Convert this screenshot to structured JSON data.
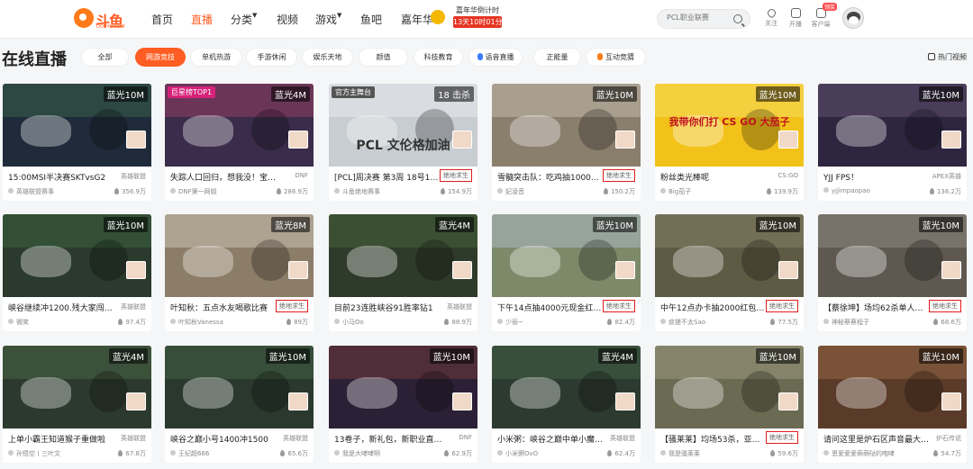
{
  "header": {
    "logo_text": "斗鱼",
    "logo_sub": "DOUYU.COM",
    "nav": [
      {
        "label": "首页",
        "active": false,
        "dropdown": false
      },
      {
        "label": "直播",
        "active": true,
        "dropdown": false
      },
      {
        "label": "分类",
        "active": false,
        "dropdown": true
      },
      {
        "label": "视频",
        "active": false,
        "dropdown": false
      },
      {
        "label": "游戏",
        "active": false,
        "dropdown": true
      },
      {
        "label": "鱼吧",
        "active": false,
        "dropdown": false
      },
      {
        "label": "嘉年华",
        "active": false,
        "dropdown": false
      }
    ],
    "countdown_title": "嘉年华倒计时",
    "countdown_value": "13天10时01分",
    "search_placeholder": "PCL职业联赛",
    "icons": [
      {
        "icon": "heart-icon",
        "label": "关注"
      },
      {
        "icon": "broadcast-icon",
        "label": "开播"
      },
      {
        "icon": "download-icon",
        "label": "客户端",
        "badge": "领奖"
      }
    ]
  },
  "page_title": "在线直播",
  "filters": [
    {
      "label": "全部",
      "active": false
    },
    {
      "label": "网游竞技",
      "active": true
    },
    {
      "label": "单机热游",
      "active": false
    },
    {
      "label": "手游休闲",
      "active": false
    },
    {
      "label": "娱乐天地",
      "active": false
    },
    {
      "label": "颜值",
      "active": false
    },
    {
      "label": "科技教育",
      "active": false
    },
    {
      "label": "语音直播",
      "active": false,
      "icon": "mic-icon"
    },
    {
      "label": "正能量",
      "active": false
    },
    {
      "label": "互动竞猜",
      "active": false,
      "icon": "flame-icon"
    }
  ],
  "hot_video": "热门视频",
  "cards": [
    {
      "title": "15:00MSI半决赛SKTvsG2",
      "category": "英雄联盟",
      "boxed": false,
      "streamer": "英雄联盟赛事",
      "views": "356.9万",
      "quality": "蓝光10M",
      "thumb": "#1f2b3a",
      "sky": "#3d6b4d"
    },
    {
      "title": "失踪人口回归，想我没！宝藏…",
      "category": "DNF",
      "boxed": false,
      "streamer": "DNF第一网姐",
      "views": "286.9万",
      "quality": "蓝光4M",
      "thumb": "#3a2c4a",
      "sky": "#a8406b",
      "badge": "巨星榜TOP1",
      "badge_color": "#d6227a"
    },
    {
      "title": "[PCL]周决赛 第3周 18号18…",
      "category": "绝地求生",
      "boxed": true,
      "streamer": "斗鱼绝地赛事",
      "views": "154.9万",
      "quality": "18 击杀",
      "thumb": "#c8cdd2",
      "sky": "#eef0f2",
      "badge": "官方主舞台",
      "badge_color": "#555",
      "overlay": "PCL 文伦格加油"
    },
    {
      "title": "雪髓突击队：吃鸡抽1000…",
      "category": "绝地求生",
      "boxed": true,
      "streamer": "妃凌音",
      "views": "150.2万",
      "quality": "蓝光10M",
      "thumb": "#8a7f6d",
      "sky": "#cfc8b8"
    },
    {
      "title": "粉丝类光棒呢",
      "category": "CS:GO",
      "boxed": false,
      "streamer": "Big茄子",
      "views": "139.9万",
      "quality": "蓝光10M",
      "thumb": "#f2c21a",
      "sky": "#f7e06a",
      "overlay": "我带你们打 CS GO 大茄子"
    },
    {
      "title": "YJJ FPS！",
      "category": "APEX英雄",
      "boxed": false,
      "streamer": "yjjimpaopao",
      "views": "136.2万",
      "quality": "蓝光10M",
      "thumb": "#2e2640",
      "sky": "#6b5a7a"
    },
    {
      "title": "峡谷继续冲1200.残大家闯…",
      "category": "英雄联盟",
      "boxed": false,
      "streamer": "微笑",
      "views": "97.4万",
      "quality": "蓝光10M",
      "thumb": "#2a3a2c",
      "sky": "#3f6d44"
    },
    {
      "title": "叶知秋：五点水友喝歌比赛",
      "category": "绝地求生",
      "boxed": true,
      "streamer": "叶知秋Vanessa",
      "views": "89万",
      "quality": "蓝光8M",
      "thumb": "#8c7d68",
      "sky": "#d8d0c0"
    },
    {
      "title": "目前23连胜峡谷91胜率钻1",
      "category": "英雄联盟",
      "boxed": false,
      "streamer": "小马Oo",
      "views": "88.9万",
      "quality": "蓝光4M",
      "thumb": "#2f3b2a",
      "sky": "#4c6a3f"
    },
    {
      "title": "下午14点抽4000元现金红…",
      "category": "绝地求生",
      "boxed": true,
      "streamer": "少丽~",
      "views": "82.4万",
      "quality": "蓝光10M",
      "thumb": "#7d8a6a",
      "sky": "#b9c4d6"
    },
    {
      "title": "中午12点办卡抽2000红包…",
      "category": "绝地求生",
      "boxed": true,
      "streamer": "痰搓不太Sao",
      "views": "77.5万",
      "quality": "蓝光10M",
      "thumb": "#5f5a44",
      "sky": "#8c8a6c"
    },
    {
      "title": "【蔡徐坤】场均62杀单人…",
      "category": "绝地求生",
      "boxed": true,
      "streamer": "神秘蔡蔡程子",
      "views": "68.6万",
      "quality": "蓝光10M",
      "thumb": "#5e5850",
      "sky": "#9a948a"
    },
    {
      "title": "上单小霸王知道猴子重做啦",
      "category": "英雄联盟",
      "boxed": false,
      "streamer": "孙悟空丨三叶文",
      "views": "67.8万",
      "quality": "蓝光4M",
      "thumb": "#2c3a2e",
      "sky": "#4f6e4a"
    },
    {
      "title": "峡谷之巅小号1400冲1500",
      "category": "英雄联盟",
      "boxed": false,
      "streamer": "王纪超666",
      "views": "65.6万",
      "quality": "蓝光10M",
      "thumb": "#2a382e",
      "sky": "#486a48"
    },
    {
      "title": "13卷子，新礼包，新职业直升…",
      "category": "DNF",
      "boxed": false,
      "streamer": "我是大哮哮啊",
      "views": "62.9万",
      "quality": "蓝光10M",
      "thumb": "#2c2036",
      "sky": "#7a3f3f"
    },
    {
      "title": "小米粥：峡谷之巅中单小魔…",
      "category": "英雄联盟",
      "boxed": false,
      "streamer": "小米粥OvO",
      "views": "62.4万",
      "quality": "蓝光4M",
      "thumb": "#2d3a30",
      "sky": "#466b4c"
    },
    {
      "title": "【骚莱莱】均场53杀，亚…",
      "category": "绝地求生",
      "boxed": true,
      "streamer": "我是骚莱莱",
      "views": "59.6万",
      "quality": "蓝光10M",
      "thumb": "#6b6a52",
      "sky": "#a7a488"
    },
    {
      "title": "请问这里是炉石区声音最大…",
      "category": "炉石传说",
      "boxed": false,
      "streamer": "恩爱爱爱萌萌哒的咆哮",
      "views": "54.7万",
      "quality": "蓝光10M",
      "thumb": "#5a3a28",
      "sky": "#a0704a"
    }
  ]
}
